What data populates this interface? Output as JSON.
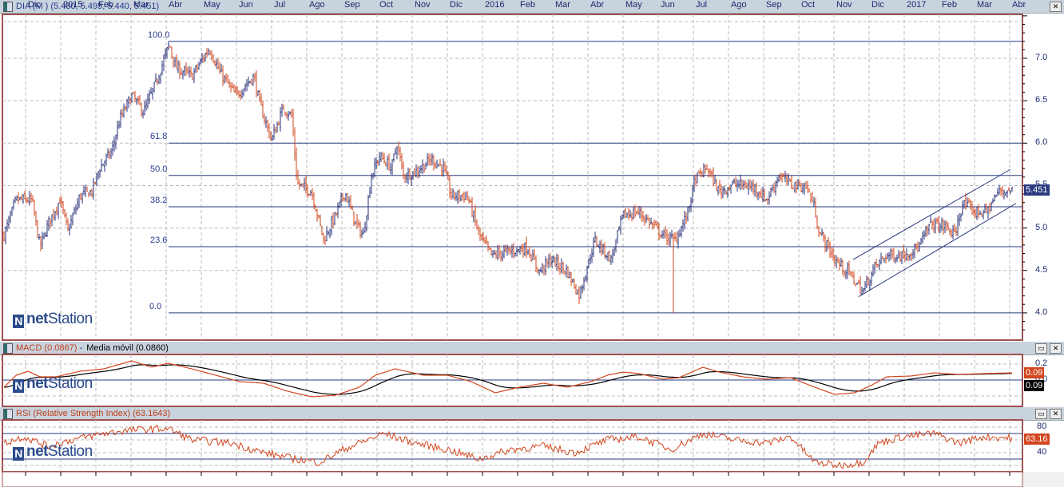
{
  "main_header": {
    "title": "DIA (M ) (5.480, 5.495, 5.440, 5.451)"
  },
  "macd_header": {
    "title": "MACD (0.0867)",
    "separator": "-",
    "signal_title": "Media móvil (0.0860)"
  },
  "rsi_header": {
    "title": "RSI (Relative Strength Index) (63.1643)"
  },
  "window_buttons": {
    "maximize": "▭",
    "close": "✕"
  },
  "logo_text": {
    "n": "N",
    "net": "net",
    "station": "Station"
  },
  "last_price_tag": "5.451",
  "macd_tags": {
    "macd": "0.09",
    "signal": "0.09"
  },
  "rsi_tag": "63.16",
  "colors": {
    "up": "#27307a",
    "down": "#d2461e",
    "frame": "#a05050",
    "fib": "#2a3a80",
    "macd": "#d2461e",
    "signal": "#000000"
  },
  "chart_data": [
    {
      "type": "ohlc",
      "title": "DIA (M )",
      "x_unit": "months since Dec 2014",
      "ylim": [
        3.78,
        7.52
      ],
      "yticks": [
        "4.0",
        "4.5",
        "5.0",
        "5.5",
        "6.0",
        "6.5",
        "7.0"
      ],
      "xticks": [
        "Dic",
        "2015",
        "Feb",
        "Mar",
        "Abr",
        "May",
        "Jun",
        "Jul",
        "Ago",
        "Sep",
        "Oct",
        "Nov",
        "Dic",
        "2016",
        "Feb",
        "Mar",
        "Abr",
        "May",
        "Jun",
        "Jul",
        "Ago",
        "Sep",
        "Oct",
        "Nov",
        "Dic",
        "2017",
        "Feb",
        "Mar",
        "Abr"
      ],
      "last": {
        "open": 5.48,
        "high": 5.495,
        "low": 5.44,
        "close": 5.451
      },
      "price_path": [
        [
          -0.66,
          4.86
        ],
        [
          -0.27,
          5.33
        ],
        [
          0.18,
          5.33
        ],
        [
          0.41,
          4.77
        ],
        [
          0.64,
          5.05
        ],
        [
          0.98,
          5.33
        ],
        [
          1.2,
          4.96
        ],
        [
          1.55,
          5.38
        ],
        [
          1.89,
          5.43
        ],
        [
          2.11,
          5.71
        ],
        [
          2.45,
          5.9
        ],
        [
          2.68,
          6.28
        ],
        [
          3.02,
          6.56
        ],
        [
          3.36,
          6.37
        ],
        [
          3.7,
          6.7
        ],
        [
          4.09,
          7.17
        ],
        [
          4.27,
          6.89
        ],
        [
          4.73,
          6.79
        ],
        [
          5.23,
          7.12
        ],
        [
          5.52,
          6.84
        ],
        [
          5.98,
          6.56
        ],
        [
          6.5,
          6.79
        ],
        [
          6.66,
          6.46
        ],
        [
          7.0,
          6.04
        ],
        [
          7.34,
          6.42
        ],
        [
          7.57,
          6.32
        ],
        [
          7.73,
          5.52
        ],
        [
          8.14,
          5.43
        ],
        [
          8.48,
          4.86
        ],
        [
          8.82,
          5.15
        ],
        [
          9.09,
          5.43
        ],
        [
          9.39,
          5.05
        ],
        [
          9.61,
          4.91
        ],
        [
          9.84,
          5.62
        ],
        [
          10.07,
          5.85
        ],
        [
          10.41,
          5.71
        ],
        [
          10.57,
          5.99
        ],
        [
          10.75,
          5.62
        ],
        [
          11.09,
          5.66
        ],
        [
          11.55,
          5.81
        ],
        [
          11.89,
          5.71
        ],
        [
          12.11,
          5.38
        ],
        [
          12.57,
          5.38
        ],
        [
          12.91,
          4.91
        ],
        [
          13.25,
          4.68
        ],
        [
          13.7,
          4.72
        ],
        [
          14.27,
          4.77
        ],
        [
          14.61,
          4.49
        ],
        [
          14.95,
          4.63
        ],
        [
          15.41,
          4.49
        ],
        [
          15.75,
          4.21
        ],
        [
          16.2,
          4.86
        ],
        [
          16.66,
          4.63
        ],
        [
          17.0,
          5.15
        ],
        [
          17.45,
          5.19
        ],
        [
          18.14,
          4.91
        ],
        [
          18.48,
          4.86
        ],
        [
          18.82,
          5.15
        ],
        [
          19.05,
          5.57
        ],
        [
          19.39,
          5.71
        ],
        [
          19.73,
          5.43
        ],
        [
          20.18,
          5.52
        ],
        [
          20.75,
          5.48
        ],
        [
          21.09,
          5.33
        ],
        [
          21.43,
          5.62
        ],
        [
          21.77,
          5.52
        ],
        [
          22.23,
          5.48
        ],
        [
          22.45,
          5.24
        ],
        [
          22.57,
          4.96
        ],
        [
          23.02,
          4.63
        ],
        [
          23.48,
          4.44
        ],
        [
          23.82,
          4.25
        ],
        [
          24.16,
          4.54
        ],
        [
          24.5,
          4.68
        ],
        [
          24.95,
          4.68
        ],
        [
          25.41,
          4.77
        ],
        [
          25.75,
          5.05
        ],
        [
          26.2,
          5.01
        ],
        [
          26.43,
          4.91
        ],
        [
          26.66,
          5.29
        ],
        [
          27.0,
          5.19
        ],
        [
          27.34,
          5.19
        ],
        [
          27.68,
          5.43
        ],
        [
          28.07,
          5.45
        ]
      ],
      "spike_low": {
        "x": 18.43,
        "low": 4.0
      },
      "fibonacci": [
        {
          "label": "100.0",
          "price": 7.2
        },
        {
          "label": "61.8",
          "price": 6.0
        },
        {
          "label": "50.0",
          "price": 5.62
        },
        {
          "label": "38.2",
          "price": 5.25
        },
        {
          "label": "23.6",
          "price": 4.78
        },
        {
          "label": "0.0",
          "price": 4.0
        }
      ],
      "fib_start_x": 4.07,
      "channel": [
        {
          "name": "upper",
          "from": [
            23.55,
            4.63
          ],
          "to": [
            28.02,
            5.69
          ]
        },
        {
          "name": "lower",
          "from": [
            23.7,
            4.19
          ],
          "to": [
            28.18,
            5.29
          ]
        }
      ]
    },
    {
      "type": "line",
      "title": "MACD",
      "ylim": [
        -0.32,
        0.32
      ],
      "yticks": [
        "0.2",
        "0.0"
      ],
      "zero_line": 0,
      "signal_smoothing": 9,
      "macd": [
        [
          -0.61,
          -0.09
        ],
        [
          -0.27,
          0.06
        ],
        [
          0.07,
          0.11
        ],
        [
          0.41,
          0.04
        ],
        [
          0.86,
          0.04
        ],
        [
          1.55,
          0.11
        ],
        [
          2.23,
          0.14
        ],
        [
          3.02,
          0.24
        ],
        [
          3.59,
          0.16
        ],
        [
          4.05,
          0.21
        ],
        [
          4.73,
          0.14
        ],
        [
          5.41,
          0.06
        ],
        [
          6.09,
          -0.02
        ],
        [
          6.77,
          -0.04
        ],
        [
          7.45,
          -0.14
        ],
        [
          8.14,
          -0.21
        ],
        [
          8.82,
          -0.19
        ],
        [
          9.5,
          -0.09
        ],
        [
          9.95,
          0.06
        ],
        [
          10.52,
          0.14
        ],
        [
          11.32,
          0.06
        ],
        [
          12.0,
          0.06
        ],
        [
          12.68,
          -0.02
        ],
        [
          13.36,
          -0.16
        ],
        [
          14.05,
          -0.09
        ],
        [
          14.73,
          -0.04
        ],
        [
          15.41,
          -0.09
        ],
        [
          16.09,
          -0.02
        ],
        [
          16.55,
          0.06
        ],
        [
          17.0,
          0.1
        ],
        [
          17.45,
          0.08
        ],
        [
          18.14,
          0.01
        ],
        [
          18.59,
          0.03
        ],
        [
          19.27,
          0.16
        ],
        [
          19.73,
          0.1
        ],
        [
          20.41,
          0.04
        ],
        [
          21.09,
          0.01
        ],
        [
          21.77,
          0.03
        ],
        [
          22.45,
          -0.09
        ],
        [
          23.02,
          -0.18
        ],
        [
          23.59,
          -0.16
        ],
        [
          24.05,
          -0.07
        ],
        [
          24.5,
          0.04
        ],
        [
          25.18,
          0.05
        ],
        [
          25.86,
          0.09
        ],
        [
          26.55,
          0.07
        ],
        [
          27.23,
          0.08
        ],
        [
          28.07,
          0.09
        ]
      ]
    },
    {
      "type": "line",
      "title": "RSI (Relative Strength Index)",
      "ylim": [
        0,
        100
      ],
      "yticks": [
        "80",
        "60",
        "40"
      ],
      "bands": [
        70,
        30
      ],
      "rsi": [
        [
          -0.61,
          55
        ],
        [
          -0.05,
          65
        ],
        [
          0.64,
          50
        ],
        [
          1.32,
          60
        ],
        [
          2.23,
          70
        ],
        [
          2.91,
          75
        ],
        [
          4.05,
          78
        ],
        [
          4.73,
          60
        ],
        [
          5.86,
          55
        ],
        [
          6.77,
          40
        ],
        [
          7.68,
          30
        ],
        [
          8.36,
          25
        ],
        [
          9.05,
          45
        ],
        [
          9.73,
          60
        ],
        [
          10.18,
          70
        ],
        [
          11.09,
          55
        ],
        [
          12.0,
          45
        ],
        [
          12.91,
          30
        ],
        [
          13.82,
          45
        ],
        [
          14.73,
          50
        ],
        [
          15.64,
          40
        ],
        [
          16.55,
          60
        ],
        [
          17.45,
          65
        ],
        [
          18.36,
          45
        ],
        [
          19.27,
          70
        ],
        [
          20.18,
          60
        ],
        [
          21.09,
          55
        ],
        [
          21.77,
          65
        ],
        [
          22.45,
          25
        ],
        [
          23.14,
          20
        ],
        [
          23.82,
          25
        ],
        [
          24.27,
          55
        ],
        [
          24.95,
          65
        ],
        [
          25.86,
          70
        ],
        [
          26.55,
          55
        ],
        [
          27.23,
          65
        ],
        [
          28.07,
          63
        ]
      ]
    }
  ]
}
